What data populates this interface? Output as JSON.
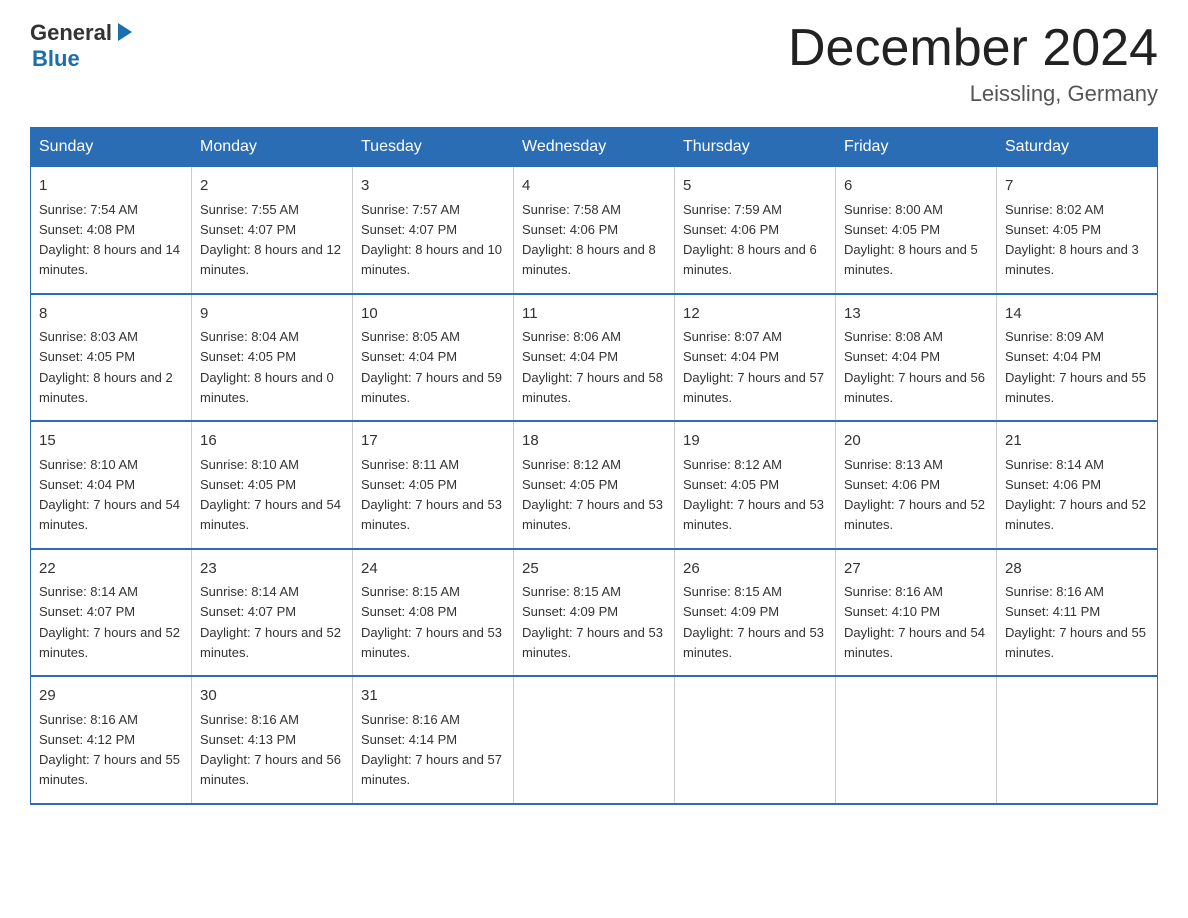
{
  "header": {
    "logo": {
      "general": "General",
      "blue": "Blue"
    },
    "month": "December 2024",
    "location": "Leissling, Germany"
  },
  "weekdays": [
    "Sunday",
    "Monday",
    "Tuesday",
    "Wednesday",
    "Thursday",
    "Friday",
    "Saturday"
  ],
  "weeks": [
    [
      {
        "day": "1",
        "sunrise": "7:54 AM",
        "sunset": "4:08 PM",
        "daylight": "8 hours and 14 minutes."
      },
      {
        "day": "2",
        "sunrise": "7:55 AM",
        "sunset": "4:07 PM",
        "daylight": "8 hours and 12 minutes."
      },
      {
        "day": "3",
        "sunrise": "7:57 AM",
        "sunset": "4:07 PM",
        "daylight": "8 hours and 10 minutes."
      },
      {
        "day": "4",
        "sunrise": "7:58 AM",
        "sunset": "4:06 PM",
        "daylight": "8 hours and 8 minutes."
      },
      {
        "day": "5",
        "sunrise": "7:59 AM",
        "sunset": "4:06 PM",
        "daylight": "8 hours and 6 minutes."
      },
      {
        "day": "6",
        "sunrise": "8:00 AM",
        "sunset": "4:05 PM",
        "daylight": "8 hours and 5 minutes."
      },
      {
        "day": "7",
        "sunrise": "8:02 AM",
        "sunset": "4:05 PM",
        "daylight": "8 hours and 3 minutes."
      }
    ],
    [
      {
        "day": "8",
        "sunrise": "8:03 AM",
        "sunset": "4:05 PM",
        "daylight": "8 hours and 2 minutes."
      },
      {
        "day": "9",
        "sunrise": "8:04 AM",
        "sunset": "4:05 PM",
        "daylight": "8 hours and 0 minutes."
      },
      {
        "day": "10",
        "sunrise": "8:05 AM",
        "sunset": "4:04 PM",
        "daylight": "7 hours and 59 minutes."
      },
      {
        "day": "11",
        "sunrise": "8:06 AM",
        "sunset": "4:04 PM",
        "daylight": "7 hours and 58 minutes."
      },
      {
        "day": "12",
        "sunrise": "8:07 AM",
        "sunset": "4:04 PM",
        "daylight": "7 hours and 57 minutes."
      },
      {
        "day": "13",
        "sunrise": "8:08 AM",
        "sunset": "4:04 PM",
        "daylight": "7 hours and 56 minutes."
      },
      {
        "day": "14",
        "sunrise": "8:09 AM",
        "sunset": "4:04 PM",
        "daylight": "7 hours and 55 minutes."
      }
    ],
    [
      {
        "day": "15",
        "sunrise": "8:10 AM",
        "sunset": "4:04 PM",
        "daylight": "7 hours and 54 minutes."
      },
      {
        "day": "16",
        "sunrise": "8:10 AM",
        "sunset": "4:05 PM",
        "daylight": "7 hours and 54 minutes."
      },
      {
        "day": "17",
        "sunrise": "8:11 AM",
        "sunset": "4:05 PM",
        "daylight": "7 hours and 53 minutes."
      },
      {
        "day": "18",
        "sunrise": "8:12 AM",
        "sunset": "4:05 PM",
        "daylight": "7 hours and 53 minutes."
      },
      {
        "day": "19",
        "sunrise": "8:12 AM",
        "sunset": "4:05 PM",
        "daylight": "7 hours and 53 minutes."
      },
      {
        "day": "20",
        "sunrise": "8:13 AM",
        "sunset": "4:06 PM",
        "daylight": "7 hours and 52 minutes."
      },
      {
        "day": "21",
        "sunrise": "8:14 AM",
        "sunset": "4:06 PM",
        "daylight": "7 hours and 52 minutes."
      }
    ],
    [
      {
        "day": "22",
        "sunrise": "8:14 AM",
        "sunset": "4:07 PM",
        "daylight": "7 hours and 52 minutes."
      },
      {
        "day": "23",
        "sunrise": "8:14 AM",
        "sunset": "4:07 PM",
        "daylight": "7 hours and 52 minutes."
      },
      {
        "day": "24",
        "sunrise": "8:15 AM",
        "sunset": "4:08 PM",
        "daylight": "7 hours and 53 minutes."
      },
      {
        "day": "25",
        "sunrise": "8:15 AM",
        "sunset": "4:09 PM",
        "daylight": "7 hours and 53 minutes."
      },
      {
        "day": "26",
        "sunrise": "8:15 AM",
        "sunset": "4:09 PM",
        "daylight": "7 hours and 53 minutes."
      },
      {
        "day": "27",
        "sunrise": "8:16 AM",
        "sunset": "4:10 PM",
        "daylight": "7 hours and 54 minutes."
      },
      {
        "day": "28",
        "sunrise": "8:16 AM",
        "sunset": "4:11 PM",
        "daylight": "7 hours and 55 minutes."
      }
    ],
    [
      {
        "day": "29",
        "sunrise": "8:16 AM",
        "sunset": "4:12 PM",
        "daylight": "7 hours and 55 minutes."
      },
      {
        "day": "30",
        "sunrise": "8:16 AM",
        "sunset": "4:13 PM",
        "daylight": "7 hours and 56 minutes."
      },
      {
        "day": "31",
        "sunrise": "8:16 AM",
        "sunset": "4:14 PM",
        "daylight": "7 hours and 57 minutes."
      },
      null,
      null,
      null,
      null
    ]
  ]
}
